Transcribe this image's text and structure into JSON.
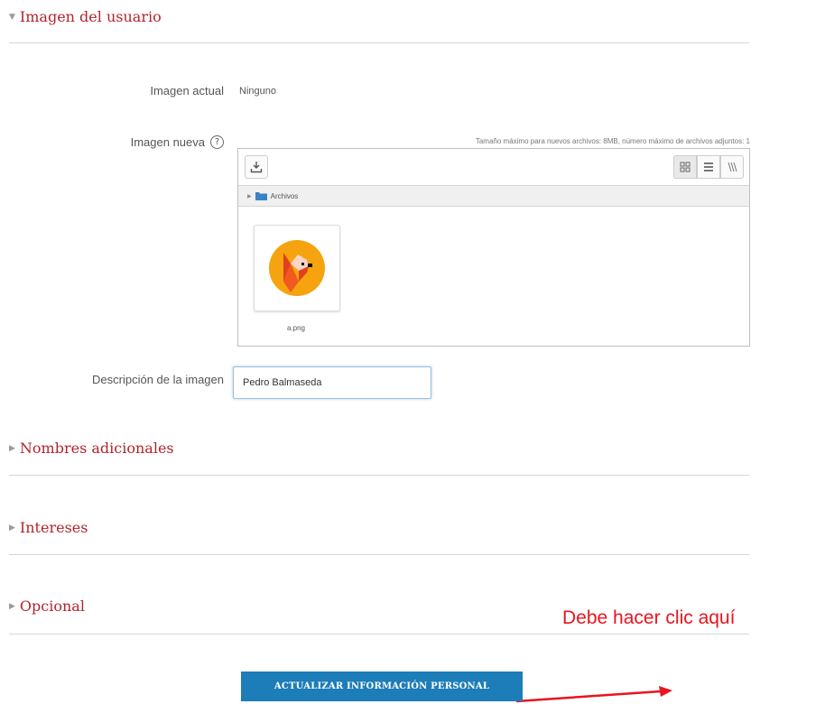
{
  "sections": {
    "user_image": "Imagen del usuario",
    "additional_names": "Nombres adicionales",
    "interests": "Intereses",
    "optional": "Opcional"
  },
  "fields": {
    "current_image_label": "Imagen actual",
    "current_image_value": "Ninguno",
    "new_image_label": "Imagen nueva",
    "description_label": "Descripción de la imagen",
    "description_value": "Pedro Balmaseda"
  },
  "filemanager": {
    "limits": "Tamaño máximo para nuevos archivos: 8MB, número máximo de archivos adjuntos: 1",
    "folder": "Archivos",
    "file_name": "a.png"
  },
  "submit_label": "ACTUALIZAR INFORMACIÓN PERSONAL",
  "annotation": "Debe hacer clic aquí",
  "colors": {
    "section_header": "#b0252e",
    "button_bg": "#1c7db8",
    "annotation": "#e8141f",
    "logo_orange": "#f5a40f",
    "logo_red": "#e0411c"
  }
}
